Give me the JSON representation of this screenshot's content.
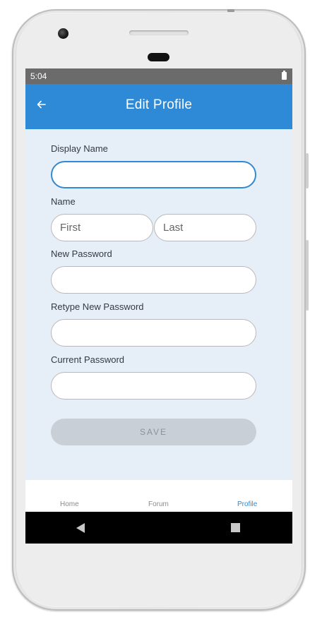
{
  "status_bar": {
    "time": "5:04"
  },
  "app_bar": {
    "title": "Edit Profile"
  },
  "form": {
    "display_name": {
      "label": "Display Name",
      "value": "",
      "placeholder": ""
    },
    "name": {
      "label": "Name",
      "first": {
        "value": "",
        "placeholder": "First"
      },
      "last": {
        "value": "",
        "placeholder": "Last"
      }
    },
    "new_password": {
      "label": "New Password",
      "value": "",
      "placeholder": ""
    },
    "retype_password": {
      "label": "Retype New Password",
      "value": "",
      "placeholder": ""
    },
    "current_password": {
      "label": "Current Password",
      "value": "",
      "placeholder": ""
    },
    "save_label": "SAVE"
  },
  "tab_bar": {
    "items": [
      {
        "label": "Home",
        "active": false
      },
      {
        "label": "Forum",
        "active": false
      },
      {
        "label": "Profile",
        "active": true
      }
    ]
  },
  "icons": {
    "back": "arrow-left-icon",
    "battery": "battery-icon",
    "nav_back": "nav-back-icon",
    "nav_recents": "nav-recents-icon"
  },
  "colors": {
    "primary": "#2e8ad6",
    "background": "#e6eef7",
    "status_bar": "#6b6b6b",
    "save_button": "#c9cfd6"
  }
}
